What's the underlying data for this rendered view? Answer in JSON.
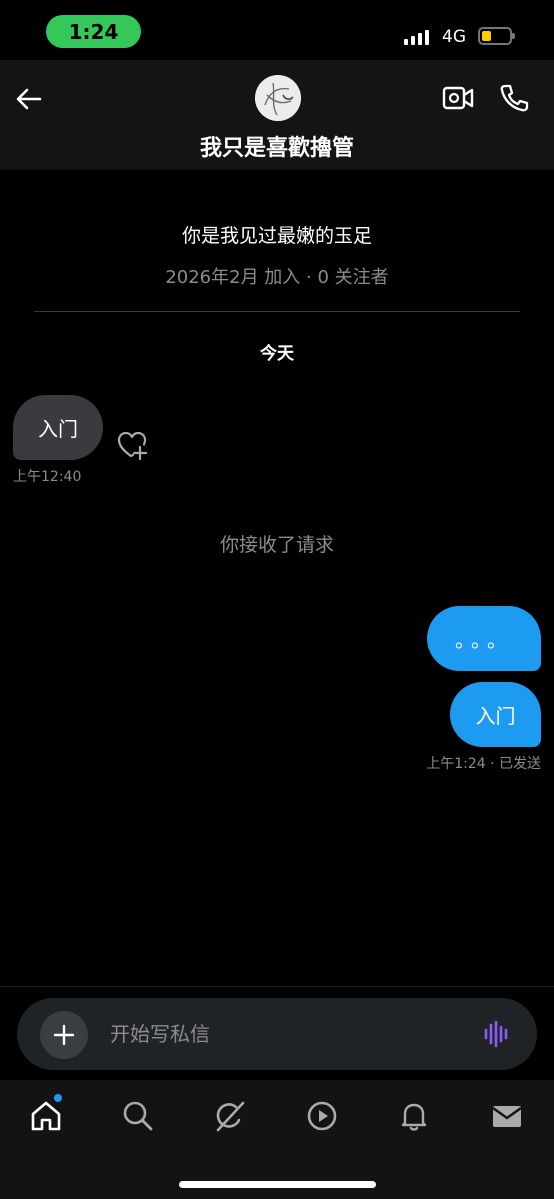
{
  "status_bar": {
    "time": "1:24",
    "network": "4G"
  },
  "header": {
    "title": "我只是喜歡擼管"
  },
  "profile": {
    "bio": "你是我见过最嫩的玉足",
    "meta": "2026年2月 加入 · 0 关注者"
  },
  "conversation": {
    "day_label": "今天",
    "messages": [
      {
        "direction": "in",
        "text": "入门"
      },
      {
        "direction": "out",
        "text": "。。。"
      },
      {
        "direction": "out",
        "text": "入门"
      }
    ],
    "incoming_time": "上午12:40",
    "system_note": "你接收了请求",
    "outgoing_status": "上午1:24 · 已发送"
  },
  "composer": {
    "placeholder": "开始写私信",
    "value": ""
  },
  "nav": {
    "items": [
      "home-icon",
      "search-icon",
      "grok-icon",
      "video-icon",
      "bell-icon",
      "mail-icon"
    ],
    "home_has_badge": true
  },
  "colors": {
    "accent": "#1d9bf0",
    "voice": "#8b5cf6",
    "status_green": "#34c759"
  }
}
